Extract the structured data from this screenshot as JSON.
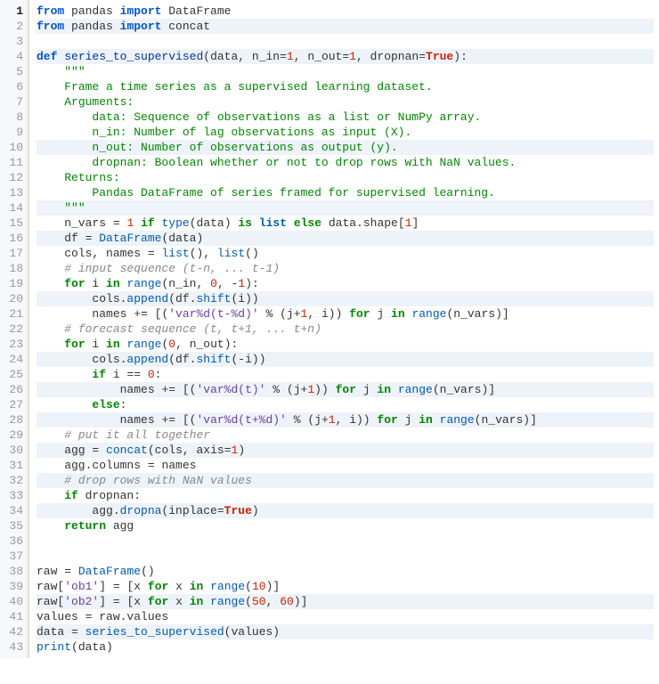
{
  "highlighted_lines": [
    2,
    4,
    10,
    14,
    16,
    20,
    24,
    26,
    28,
    30,
    32,
    34,
    40,
    42
  ],
  "current_line": 1,
  "lines": [
    [
      [
        "kw2",
        "from"
      ],
      [
        "name",
        " pandas "
      ],
      [
        "kw2",
        "import"
      ],
      [
        "name",
        " DataFrame"
      ]
    ],
    [
      [
        "kw2",
        "from"
      ],
      [
        "name",
        " pandas "
      ],
      [
        "kw2",
        "import"
      ],
      [
        "name",
        " concat"
      ]
    ],
    [
      [
        "name",
        ""
      ]
    ],
    [
      [
        "kw2",
        "def"
      ],
      [
        "name",
        " "
      ],
      [
        "fn",
        "series_to_supervised"
      ],
      [
        "op",
        "("
      ],
      [
        "name",
        "data"
      ],
      [
        "op",
        ","
      ],
      [
        "name",
        " n_in"
      ],
      [
        "op",
        "="
      ],
      [
        "num",
        "1"
      ],
      [
        "op",
        ","
      ],
      [
        "name",
        " n_out"
      ],
      [
        "op",
        "="
      ],
      [
        "num",
        "1"
      ],
      [
        "op",
        ","
      ],
      [
        "name",
        " dropnan"
      ],
      [
        "op",
        "="
      ],
      [
        "bool",
        "True"
      ],
      [
        "op",
        ")"
      ],
      [
        "op",
        ":"
      ]
    ],
    [
      [
        "name",
        "    "
      ],
      [
        "doc",
        "\"\"\""
      ]
    ],
    [
      [
        "name",
        "    "
      ],
      [
        "doc",
        "Frame a time series as a supervised learning dataset."
      ]
    ],
    [
      [
        "name",
        "    "
      ],
      [
        "doc",
        "Arguments:"
      ]
    ],
    [
      [
        "name",
        "        "
      ],
      [
        "doc",
        "data: Sequence of observations as a list or NumPy array."
      ]
    ],
    [
      [
        "name",
        "        "
      ],
      [
        "doc",
        "n_in: Number of lag observations as input (X)."
      ]
    ],
    [
      [
        "name",
        "        "
      ],
      [
        "doc",
        "n_out: Number of observations as output (y)."
      ]
    ],
    [
      [
        "name",
        "        "
      ],
      [
        "doc",
        "dropnan: Boolean whether or not to drop rows with NaN values."
      ]
    ],
    [
      [
        "name",
        "    "
      ],
      [
        "doc",
        "Returns:"
      ]
    ],
    [
      [
        "name",
        "        "
      ],
      [
        "doc",
        "Pandas DataFrame of series framed for supervised learning."
      ]
    ],
    [
      [
        "name",
        "    "
      ],
      [
        "doc",
        "\"\"\""
      ]
    ],
    [
      [
        "name",
        "    n_vars "
      ],
      [
        "op",
        "="
      ],
      [
        "name",
        " "
      ],
      [
        "num",
        "1"
      ],
      [
        "name",
        " "
      ],
      [
        "kw",
        "if"
      ],
      [
        "name",
        " "
      ],
      [
        "call",
        "type"
      ],
      [
        "op",
        "("
      ],
      [
        "name",
        "data"
      ],
      [
        "op",
        ")"
      ],
      [
        "name",
        " "
      ],
      [
        "kw",
        "is"
      ],
      [
        "name",
        " "
      ],
      [
        "type",
        "list"
      ],
      [
        "name",
        " "
      ],
      [
        "kw",
        "else"
      ],
      [
        "name",
        " data.shape"
      ],
      [
        "op",
        "["
      ],
      [
        "num",
        "1"
      ],
      [
        "op",
        "]"
      ]
    ],
    [
      [
        "name",
        "    df "
      ],
      [
        "op",
        "="
      ],
      [
        "name",
        " "
      ],
      [
        "call",
        "DataFrame"
      ],
      [
        "op",
        "("
      ],
      [
        "name",
        "data"
      ],
      [
        "op",
        ")"
      ]
    ],
    [
      [
        "name",
        "    cols"
      ],
      [
        "op",
        ","
      ],
      [
        "name",
        " names "
      ],
      [
        "op",
        "="
      ],
      [
        "name",
        " "
      ],
      [
        "call",
        "list"
      ],
      [
        "op",
        "()"
      ],
      [
        "op",
        ","
      ],
      [
        "name",
        " "
      ],
      [
        "call",
        "list"
      ],
      [
        "op",
        "()"
      ]
    ],
    [
      [
        "name",
        "    "
      ],
      [
        "cmt",
        "# input sequence (t-n, ... t-1)"
      ]
    ],
    [
      [
        "name",
        "    "
      ],
      [
        "kw",
        "for"
      ],
      [
        "name",
        " i "
      ],
      [
        "kw",
        "in"
      ],
      [
        "name",
        " "
      ],
      [
        "call",
        "range"
      ],
      [
        "op",
        "("
      ],
      [
        "name",
        "n_in"
      ],
      [
        "op",
        ","
      ],
      [
        "name",
        " "
      ],
      [
        "num",
        "0"
      ],
      [
        "op",
        ","
      ],
      [
        "name",
        " "
      ],
      [
        "op",
        "-"
      ],
      [
        "num",
        "1"
      ],
      [
        "op",
        ")"
      ],
      [
        "op",
        ":"
      ]
    ],
    [
      [
        "name",
        "        cols."
      ],
      [
        "call",
        "append"
      ],
      [
        "op",
        "("
      ],
      [
        "name",
        "df."
      ],
      [
        "call",
        "shift"
      ],
      [
        "op",
        "("
      ],
      [
        "name",
        "i"
      ],
      [
        "op",
        "))"
      ]
    ],
    [
      [
        "name",
        "        names "
      ],
      [
        "op",
        "+="
      ],
      [
        "name",
        " "
      ],
      [
        "op",
        "[("
      ],
      [
        "str",
        "'var%d(t-%d)'"
      ],
      [
        "name",
        " "
      ],
      [
        "op",
        "%"
      ],
      [
        "name",
        " "
      ],
      [
        "op",
        "("
      ],
      [
        "name",
        "j"
      ],
      [
        "op",
        "+"
      ],
      [
        "num",
        "1"
      ],
      [
        "op",
        ","
      ],
      [
        "name",
        " i"
      ],
      [
        "op",
        "))"
      ],
      [
        "name",
        " "
      ],
      [
        "kw",
        "for"
      ],
      [
        "name",
        " j "
      ],
      [
        "kw",
        "in"
      ],
      [
        "name",
        " "
      ],
      [
        "call",
        "range"
      ],
      [
        "op",
        "("
      ],
      [
        "name",
        "n_vars"
      ],
      [
        "op",
        ")]"
      ]
    ],
    [
      [
        "name",
        "    "
      ],
      [
        "cmt",
        "# forecast sequence (t, t+1, ... t+n)"
      ]
    ],
    [
      [
        "name",
        "    "
      ],
      [
        "kw",
        "for"
      ],
      [
        "name",
        " i "
      ],
      [
        "kw",
        "in"
      ],
      [
        "name",
        " "
      ],
      [
        "call",
        "range"
      ],
      [
        "op",
        "("
      ],
      [
        "num",
        "0"
      ],
      [
        "op",
        ","
      ],
      [
        "name",
        " n_out"
      ],
      [
        "op",
        ")"
      ],
      [
        "op",
        ":"
      ]
    ],
    [
      [
        "name",
        "        cols."
      ],
      [
        "call",
        "append"
      ],
      [
        "op",
        "("
      ],
      [
        "name",
        "df."
      ],
      [
        "call",
        "shift"
      ],
      [
        "op",
        "("
      ],
      [
        "op",
        "-"
      ],
      [
        "name",
        "i"
      ],
      [
        "op",
        "))"
      ]
    ],
    [
      [
        "name",
        "        "
      ],
      [
        "kw",
        "if"
      ],
      [
        "name",
        " i "
      ],
      [
        "op",
        "=="
      ],
      [
        "name",
        " "
      ],
      [
        "num",
        "0"
      ],
      [
        "op",
        ":"
      ]
    ],
    [
      [
        "name",
        "            names "
      ],
      [
        "op",
        "+="
      ],
      [
        "name",
        " "
      ],
      [
        "op",
        "[("
      ],
      [
        "str",
        "'var%d(t)'"
      ],
      [
        "name",
        " "
      ],
      [
        "op",
        "%"
      ],
      [
        "name",
        " "
      ],
      [
        "op",
        "("
      ],
      [
        "name",
        "j"
      ],
      [
        "op",
        "+"
      ],
      [
        "num",
        "1"
      ],
      [
        "op",
        "))"
      ],
      [
        "name",
        " "
      ],
      [
        "kw",
        "for"
      ],
      [
        "name",
        " j "
      ],
      [
        "kw",
        "in"
      ],
      [
        "name",
        " "
      ],
      [
        "call",
        "range"
      ],
      [
        "op",
        "("
      ],
      [
        "name",
        "n_vars"
      ],
      [
        "op",
        ")]"
      ]
    ],
    [
      [
        "name",
        "        "
      ],
      [
        "kw",
        "else"
      ],
      [
        "op",
        ":"
      ]
    ],
    [
      [
        "name",
        "            names "
      ],
      [
        "op",
        "+="
      ],
      [
        "name",
        " "
      ],
      [
        "op",
        "[("
      ],
      [
        "str",
        "'var%d(t+%d)'"
      ],
      [
        "name",
        " "
      ],
      [
        "op",
        "%"
      ],
      [
        "name",
        " "
      ],
      [
        "op",
        "("
      ],
      [
        "name",
        "j"
      ],
      [
        "op",
        "+"
      ],
      [
        "num",
        "1"
      ],
      [
        "op",
        ","
      ],
      [
        "name",
        " i"
      ],
      [
        "op",
        "))"
      ],
      [
        "name",
        " "
      ],
      [
        "kw",
        "for"
      ],
      [
        "name",
        " j "
      ],
      [
        "kw",
        "in"
      ],
      [
        "name",
        " "
      ],
      [
        "call",
        "range"
      ],
      [
        "op",
        "("
      ],
      [
        "name",
        "n_vars"
      ],
      [
        "op",
        ")]"
      ]
    ],
    [
      [
        "name",
        "    "
      ],
      [
        "cmt",
        "# put it all together"
      ]
    ],
    [
      [
        "name",
        "    agg "
      ],
      [
        "op",
        "="
      ],
      [
        "name",
        " "
      ],
      [
        "call",
        "concat"
      ],
      [
        "op",
        "("
      ],
      [
        "name",
        "cols"
      ],
      [
        "op",
        ","
      ],
      [
        "name",
        " axis"
      ],
      [
        "op",
        "="
      ],
      [
        "num",
        "1"
      ],
      [
        "op",
        ")"
      ]
    ],
    [
      [
        "name",
        "    agg.columns "
      ],
      [
        "op",
        "="
      ],
      [
        "name",
        " names"
      ]
    ],
    [
      [
        "name",
        "    "
      ],
      [
        "cmt",
        "# drop rows with NaN values"
      ]
    ],
    [
      [
        "name",
        "    "
      ],
      [
        "kw",
        "if"
      ],
      [
        "name",
        " dropnan"
      ],
      [
        "op",
        ":"
      ]
    ],
    [
      [
        "name",
        "        agg."
      ],
      [
        "call",
        "dropna"
      ],
      [
        "op",
        "("
      ],
      [
        "name",
        "inplace"
      ],
      [
        "op",
        "="
      ],
      [
        "bool",
        "True"
      ],
      [
        "op",
        ")"
      ]
    ],
    [
      [
        "name",
        "    "
      ],
      [
        "kw",
        "return"
      ],
      [
        "name",
        " agg"
      ]
    ],
    [
      [
        "name",
        ""
      ]
    ],
    [
      [
        "name",
        ""
      ]
    ],
    [
      [
        "name",
        "raw "
      ],
      [
        "op",
        "="
      ],
      [
        "name",
        " "
      ],
      [
        "call",
        "DataFrame"
      ],
      [
        "op",
        "()"
      ]
    ],
    [
      [
        "name",
        "raw"
      ],
      [
        "op",
        "["
      ],
      [
        "str",
        "'ob1'"
      ],
      [
        "op",
        "]"
      ],
      [
        "name",
        " "
      ],
      [
        "op",
        "="
      ],
      [
        "name",
        " "
      ],
      [
        "op",
        "["
      ],
      [
        "name",
        "x "
      ],
      [
        "kw",
        "for"
      ],
      [
        "name",
        " x "
      ],
      [
        "kw",
        "in"
      ],
      [
        "name",
        " "
      ],
      [
        "call",
        "range"
      ],
      [
        "op",
        "("
      ],
      [
        "num",
        "10"
      ],
      [
        "op",
        ")]"
      ]
    ],
    [
      [
        "name",
        "raw"
      ],
      [
        "op",
        "["
      ],
      [
        "str",
        "'ob2'"
      ],
      [
        "op",
        "]"
      ],
      [
        "name",
        " "
      ],
      [
        "op",
        "="
      ],
      [
        "name",
        " "
      ],
      [
        "op",
        "["
      ],
      [
        "name",
        "x "
      ],
      [
        "kw",
        "for"
      ],
      [
        "name",
        " x "
      ],
      [
        "kw",
        "in"
      ],
      [
        "name",
        " "
      ],
      [
        "call",
        "range"
      ],
      [
        "op",
        "("
      ],
      [
        "num",
        "50"
      ],
      [
        "op",
        ","
      ],
      [
        "name",
        " "
      ],
      [
        "num",
        "60"
      ],
      [
        "op",
        ")]"
      ]
    ],
    [
      [
        "name",
        "values "
      ],
      [
        "op",
        "="
      ],
      [
        "name",
        " raw.values"
      ]
    ],
    [
      [
        "name",
        "data "
      ],
      [
        "op",
        "="
      ],
      [
        "name",
        " "
      ],
      [
        "call",
        "series_to_supervised"
      ],
      [
        "op",
        "("
      ],
      [
        "name",
        "values"
      ],
      [
        "op",
        ")"
      ]
    ],
    [
      [
        "call",
        "print"
      ],
      [
        "op",
        "("
      ],
      [
        "name",
        "data"
      ],
      [
        "op",
        ")"
      ]
    ]
  ]
}
